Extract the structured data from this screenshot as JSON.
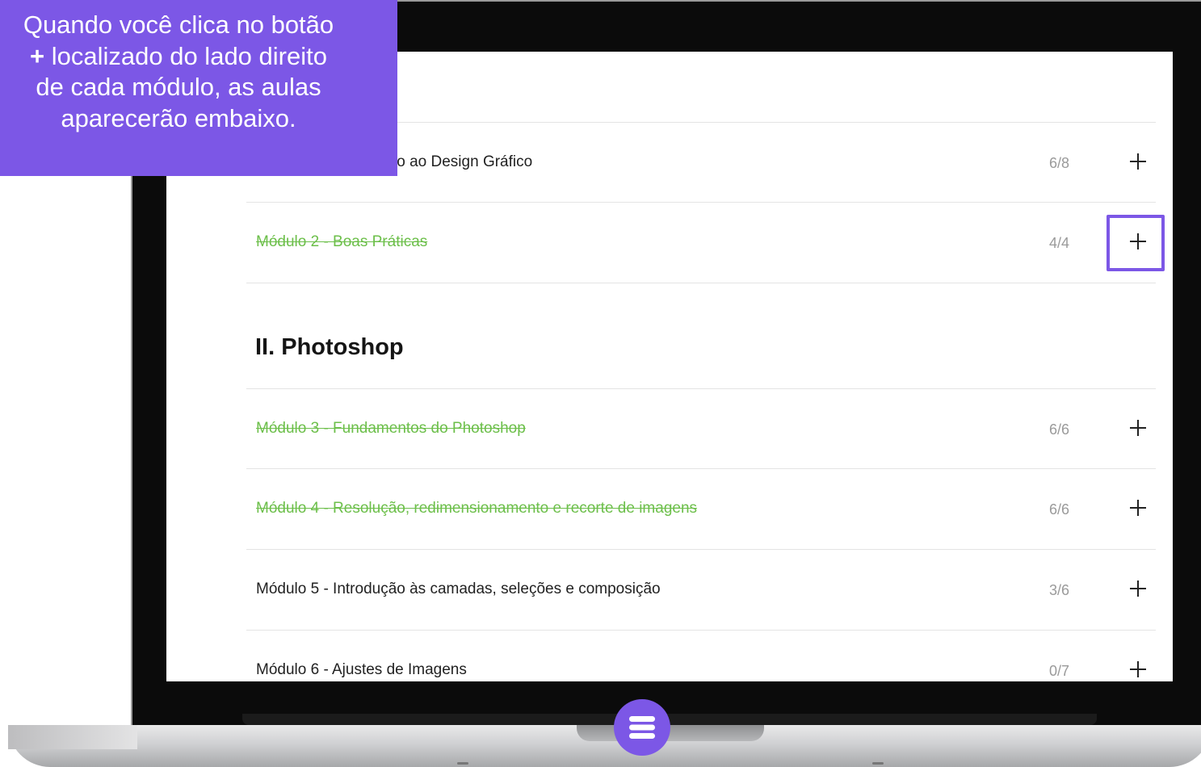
{
  "tooltip": {
    "line1": "Quando você clica no botão",
    "line2_plus": "+",
    "line2_text": " localizado do lado direito",
    "line3": "de cada módulo, as aulas",
    "line4": "aparecerão embaixo."
  },
  "sections": [
    {
      "title": "",
      "modules": [
        {
          "label": "Módulo 1 - Introdução ao Design Gráfico",
          "count": "6/8",
          "completed": false
        },
        {
          "label": "Módulo 2 - Boas Práticas",
          "count": "4/4",
          "completed": true
        }
      ]
    },
    {
      "title": "II. Photoshop",
      "modules": [
        {
          "label": "Módulo 3 - Fundamentos do Photoshop",
          "count": "6/6",
          "completed": true
        },
        {
          "label": "Módulo 4 - Resolução, redimensionamento e recorte de imagens",
          "count": "6/6",
          "completed": true
        },
        {
          "label": "Módulo 5 - Introdução às camadas, seleções e composição",
          "count": "3/6",
          "completed": false
        },
        {
          "label": "Módulo 6 - Ajustes de Imagens",
          "count": "0/7",
          "completed": false
        }
      ]
    }
  ],
  "icons": {
    "expand": "plus-icon",
    "menu": "hamburger-menu-icon"
  },
  "colors": {
    "accent": "#7c57e6",
    "completed": "#6cbf4a",
    "count": "#9a9a9a"
  }
}
